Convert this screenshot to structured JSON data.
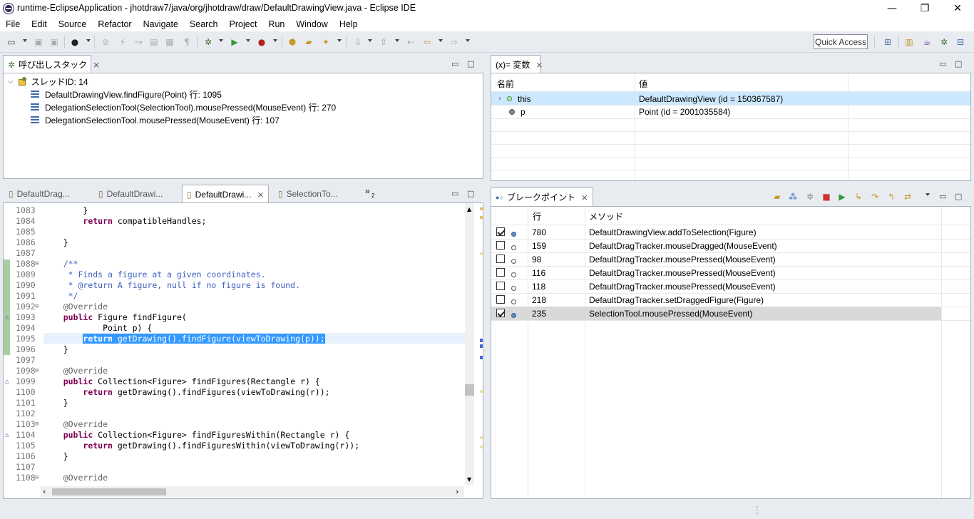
{
  "window": {
    "title": "runtime-EclipseApplication - jhotdraw7/java/org/jhotdraw/draw/DefaultDrawingView.java - Eclipse IDE",
    "minimize": "—",
    "maximize": "❐",
    "close": "✕"
  },
  "menu": [
    "File",
    "Edit",
    "Source",
    "Refactor",
    "Navigate",
    "Search",
    "Project",
    "Run",
    "Window",
    "Help"
  ],
  "toolbar": {
    "quick_access": "Quick Access"
  },
  "callstack": {
    "tab": "呼び出しスタック",
    "thread": "スレッドID: 14",
    "frames": [
      "DefaultDrawingView.findFigure(Point) 行: 1095",
      "DelegationSelectionTool(SelectionTool).mousePressed(MouseEvent) 行: 270",
      "DelegationSelectionTool.mousePressed(MouseEvent) 行: 107"
    ]
  },
  "variables": {
    "tab": "(x)= 変数",
    "col_name": "名前",
    "col_value": "値",
    "rows": [
      {
        "name": "this",
        "value": "DefaultDrawingView (id = 150367587)"
      },
      {
        "name": "p",
        "value": "Point (id = 2001035584)"
      }
    ]
  },
  "editor": {
    "tabs": [
      "DefaultDrag...",
      "DefaultDrawi...",
      "DefaultDrawi...",
      "SelectionTo..."
    ],
    "overflow": "»",
    "overflow_count": "2",
    "lines": [
      {
        "n": "1083",
        "code": "        }"
      },
      {
        "n": "1084",
        "code": "        return compatibleHandles;"
      },
      {
        "n": "1085",
        "code": ""
      },
      {
        "n": "1086",
        "code": "    }"
      },
      {
        "n": "1087",
        "code": ""
      },
      {
        "n": "1088",
        "code": "    /**"
      },
      {
        "n": "1089",
        "code": "     * Finds a figure at a given coordinates."
      },
      {
        "n": "1090",
        "code": "     * @return A figure, null if no figure is found."
      },
      {
        "n": "1091",
        "code": "     */"
      },
      {
        "n": "1092",
        "code": "    @Override"
      },
      {
        "n": "1093",
        "code": "    public Figure findFigure("
      },
      {
        "n": "1094",
        "code": "            Point p) {"
      },
      {
        "n": "1095",
        "code": "        return getDrawing().findFigure(viewToDrawing(p));"
      },
      {
        "n": "1096",
        "code": "    }"
      },
      {
        "n": "1097",
        "code": ""
      },
      {
        "n": "1098",
        "code": "    @Override"
      },
      {
        "n": "1099",
        "code": "    public Collection<Figure> findFigures(Rectangle r) {"
      },
      {
        "n": "1100",
        "code": "        return getDrawing().findFigures(viewToDrawing(r));"
      },
      {
        "n": "1101",
        "code": "    }"
      },
      {
        "n": "1102",
        "code": ""
      },
      {
        "n": "1103",
        "code": "    @Override"
      },
      {
        "n": "1104",
        "code": "    public Collection<Figure> findFiguresWithin(Rectangle r) {"
      },
      {
        "n": "1105",
        "code": "        return getDrawing().findFiguresWithin(viewToDrawing(r));"
      },
      {
        "n": "1106",
        "code": "    }"
      },
      {
        "n": "1107",
        "code": ""
      },
      {
        "n": "1108",
        "code": "    @Override"
      }
    ]
  },
  "breakpoints": {
    "tab": "ブレークポイント",
    "col_line": "行",
    "col_method": "メソッド",
    "rows": [
      {
        "line": "780",
        "method": "DefaultDrawingView.addToSelection(Figure)",
        "checked": true
      },
      {
        "line": "159",
        "method": "DefaultDragTracker.mouseDragged(MouseEvent)",
        "checked": false
      },
      {
        "line": "98",
        "method": "DefaultDragTracker.mousePressed(MouseEvent)",
        "checked": false
      },
      {
        "line": "116",
        "method": "DefaultDragTracker.mousePressed(MouseEvent)",
        "checked": false
      },
      {
        "line": "118",
        "method": "DefaultDragTracker.mousePressed(MouseEvent)",
        "checked": false
      },
      {
        "line": "218",
        "method": "DefaultDragTracker.setDraggedFigure(Figure)",
        "checked": false
      },
      {
        "line": "235",
        "method": "SelectionTool.mousePressed(MouseEvent)",
        "checked": true
      }
    ]
  },
  "colors": {
    "keyword": "#7f0055",
    "comment": "#3f5fbf",
    "annotation": "#646464",
    "selection": "#3399ff",
    "row_selected": "#cce8ff"
  }
}
